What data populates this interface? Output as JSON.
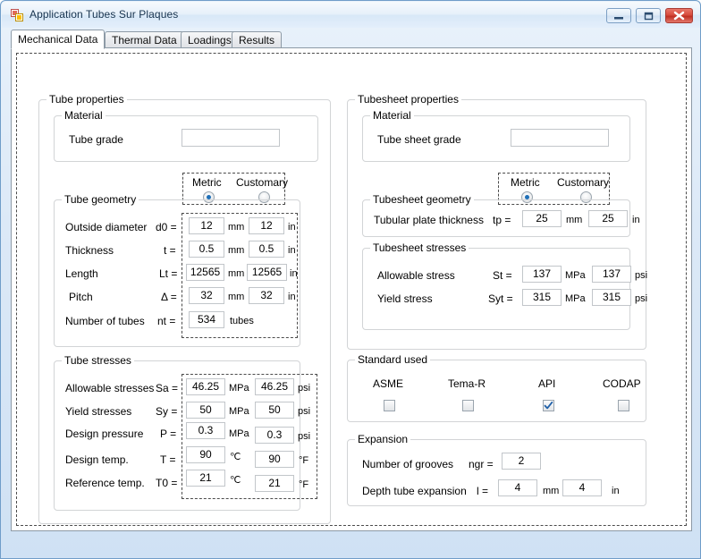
{
  "window": {
    "title": "Application Tubes Sur Plaques",
    "icon": "form-designer-icon",
    "buttons": {
      "minimize": "minimize-icon",
      "maximize": "maximize-icon",
      "close": "close-icon"
    }
  },
  "tabs": [
    {
      "label": "Mechanical Data",
      "active": true
    },
    {
      "label": "Thermal Data",
      "active": false
    },
    {
      "label": "Loadings",
      "active": false
    },
    {
      "label": "Results",
      "active": false
    }
  ],
  "tube_properties": {
    "title": "Tube properties",
    "material": {
      "title": "Material",
      "grade_label": "Tube grade",
      "grade_value": ""
    },
    "units": {
      "metric_label": "Metric",
      "customary_label": "Customary",
      "selected": "Metric"
    },
    "geometry": {
      "title": "Tube geometry",
      "rows": [
        {
          "label": "Outside diameter",
          "symbol": "d0 =",
          "metric_value": "12",
          "metric_unit": "mm",
          "cust_value": "12",
          "cust_unit": "in"
        },
        {
          "label": "Thickness",
          "symbol": "t =",
          "metric_value": "0.5",
          "metric_unit": "mm",
          "cust_value": "0.5",
          "cust_unit": "in"
        },
        {
          "label": "Length",
          "symbol": "Lt =",
          "metric_value": "12565",
          "metric_unit": "mm",
          "cust_value": "12565",
          "cust_unit": "in"
        },
        {
          "label": "Pitch",
          "symbol": "Δ =",
          "metric_value": "32",
          "metric_unit": "mm",
          "cust_value": "32",
          "cust_unit": "in"
        },
        {
          "label": "Number of tubes",
          "symbol": "nt =",
          "metric_value": "534",
          "metric_unit": "tubes",
          "cust_value": "",
          "cust_unit": ""
        }
      ]
    },
    "stresses": {
      "title": "Tube stresses",
      "rows": [
        {
          "label": "Allowable stresses",
          "symbol": "Sa =",
          "metric_value": "46.25",
          "metric_unit": "MPa",
          "cust_value": "46.25",
          "cust_unit": "psi"
        },
        {
          "label": "Yield stresses",
          "symbol": "Sy =",
          "metric_value": "50",
          "metric_unit": "MPa",
          "cust_value": "50",
          "cust_unit": "psi"
        },
        {
          "label": "Design pressure",
          "symbol": "P =",
          "metric_value": "0.3",
          "metric_unit": "MPa",
          "cust_value": "0.3",
          "cust_unit": "psi"
        },
        {
          "label": "Design temp.",
          "symbol": "T =",
          "metric_value": "90",
          "metric_unit": "℃",
          "cust_value": "90",
          "cust_unit": "°F"
        },
        {
          "label": "Reference temp.",
          "symbol": "T0 =",
          "metric_value": "21",
          "metric_unit": "℃",
          "cust_value": "21",
          "cust_unit": "°F"
        }
      ]
    }
  },
  "tubesheet_properties": {
    "title": "Tubesheet properties",
    "material": {
      "title": "Material",
      "grade_label": "Tube sheet grade",
      "grade_value": ""
    },
    "units": {
      "metric_label": "Metric",
      "customary_label": "Customary",
      "selected": "Metric"
    },
    "geometry": {
      "title": "Tubesheet geometry",
      "rows": [
        {
          "label": "Tubular plate thickness",
          "symbol": "tp =",
          "metric_value": "25",
          "metric_unit": "mm",
          "cust_value": "25",
          "cust_unit": "in"
        }
      ]
    },
    "stresses": {
      "title": "Tubesheet stresses",
      "rows": [
        {
          "label": "Allowable stress",
          "symbol": "St =",
          "metric_value": "137",
          "metric_unit": "MPa",
          "cust_value": "137",
          "cust_unit": "psi"
        },
        {
          "label": "Yield stress",
          "symbol": "Syt =",
          "metric_value": "315",
          "metric_unit": "MPa",
          "cust_value": "315",
          "cust_unit": "psi"
        }
      ]
    }
  },
  "standard_used": {
    "title": "Standard used",
    "options": [
      {
        "label": "ASME",
        "checked": false
      },
      {
        "label": "Tema-R",
        "checked": false
      },
      {
        "label": "API",
        "checked": true
      },
      {
        "label": "CODAP",
        "checked": false
      }
    ]
  },
  "expansion": {
    "title": "Expansion",
    "rows": [
      {
        "label": "Number of grooves",
        "symbol": "ngr =",
        "metric_value": "2",
        "metric_unit": "",
        "cust_value": "",
        "cust_unit": ""
      },
      {
        "label": "Depth tube expansion",
        "symbol": "l =",
        "metric_value": "4",
        "metric_unit": "mm",
        "cust_value": "4",
        "cust_unit": "in"
      }
    ]
  },
  "colors": {
    "accent": "#2070b8",
    "close_button": "#c4382a",
    "window_border": "#6f9dc9",
    "group_border": "#d2d4d6"
  }
}
